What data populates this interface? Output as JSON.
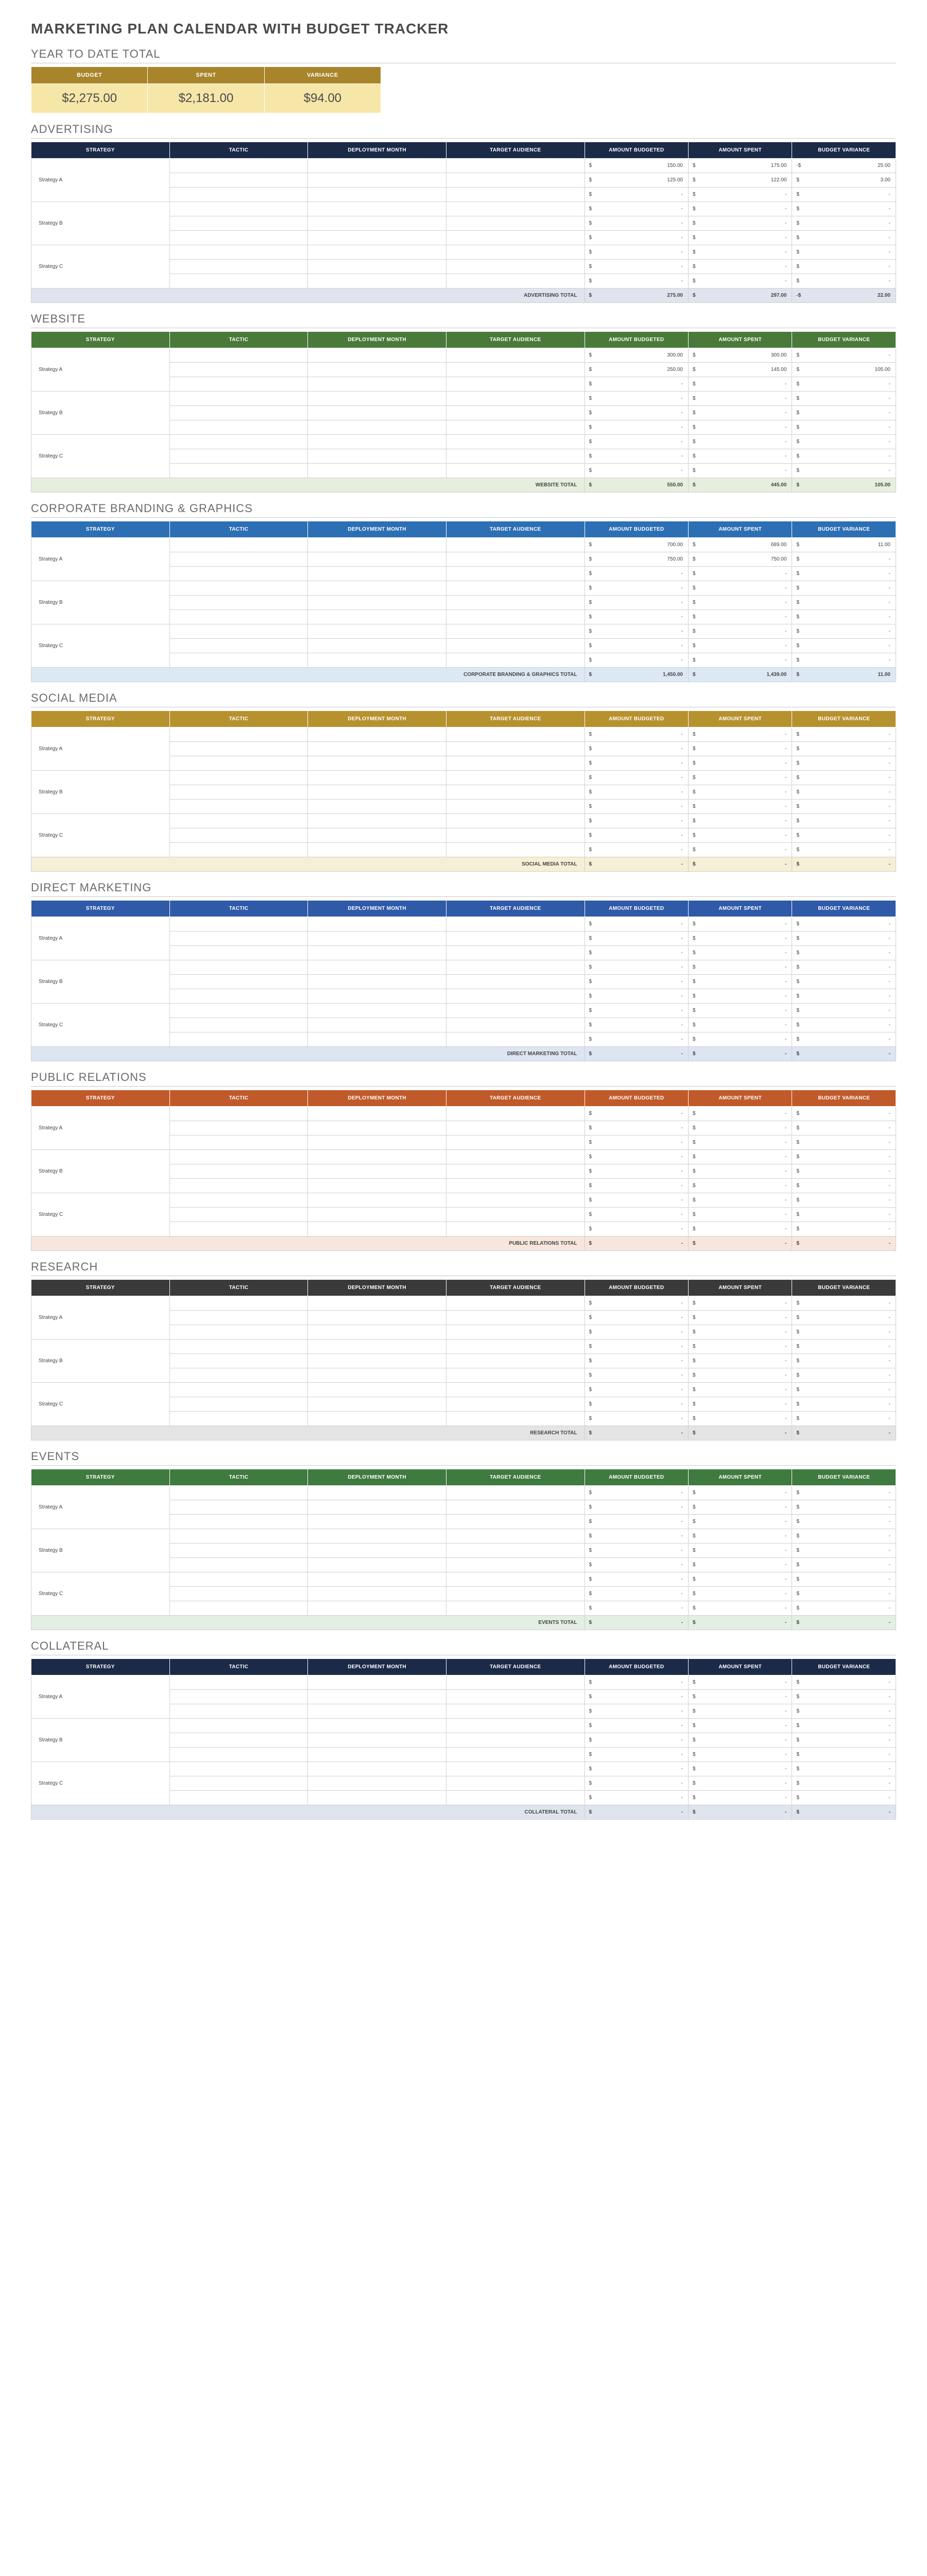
{
  "title": "MARKETING PLAN CALENDAR WITH BUDGET TRACKER",
  "ytd": {
    "title": "YEAR TO DATE TOTAL",
    "headers": {
      "budget": "BUDGET",
      "spent": "SPENT",
      "variance": "VARIANCE"
    },
    "values": {
      "budget": "$2,275.00",
      "spent": "$2,181.00",
      "variance": "$94.00"
    }
  },
  "columns": {
    "strategy": "STRATEGY",
    "tactic": "TACTIC",
    "month": "DEPLOYMENT MONTH",
    "audience": "TARGET AUDIENCE",
    "budgeted": "AMOUNT BUDGETED",
    "spent": "AMOUNT SPENT",
    "variance": "BUDGET VARIANCE"
  },
  "currency": "$",
  "dash": "-",
  "strategies": {
    "a": "Strategy A",
    "b": "Strategy B",
    "c": "Strategy C"
  },
  "sections": [
    {
      "id": "advertising",
      "title": "ADVERTISING",
      "hdrClass": "hdr-navy",
      "totClass": "tot-navy",
      "rows": [
        {
          "strategy": "a",
          "span": 3,
          "cells": [
            {
              "budgeted": "150.00",
              "spent": "175.00",
              "variance": "25.00",
              "varNeg": true
            },
            {
              "budgeted": "125.00",
              "spent": "122.00",
              "variance": "3.00"
            },
            {}
          ]
        },
        {
          "strategy": "b",
          "span": 3,
          "cells": [
            {},
            {},
            {}
          ]
        },
        {
          "strategy": "c",
          "span": 3,
          "cells": [
            {},
            {},
            {}
          ]
        }
      ],
      "total": {
        "label": "ADVERTISING TOTAL",
        "budgeted": "275.00",
        "spent": "297.00",
        "variance": "22.00",
        "varNeg": true
      }
    },
    {
      "id": "website",
      "title": "WEBSITE",
      "hdrClass": "hdr-green",
      "totClass": "tot-green",
      "rows": [
        {
          "strategy": "a",
          "span": 3,
          "cells": [
            {
              "budgeted": "300.00",
              "spent": "300.00",
              "variance": "-"
            },
            {
              "budgeted": "250.00",
              "spent": "145.00",
              "variance": "105.00"
            },
            {}
          ]
        },
        {
          "strategy": "b",
          "span": 3,
          "cells": [
            {},
            {},
            {}
          ]
        },
        {
          "strategy": "c",
          "span": 3,
          "cells": [
            {},
            {},
            {}
          ]
        }
      ],
      "total": {
        "label": "WEBSITE TOTAL",
        "budgeted": "550.00",
        "spent": "445.00",
        "variance": "105.00"
      }
    },
    {
      "id": "corporate",
      "title": "CORPORATE BRANDING & GRAPHICS",
      "hdrClass": "hdr-blue",
      "totClass": "tot-blue",
      "rows": [
        {
          "strategy": "a",
          "span": 3,
          "cells": [
            {
              "budgeted": "700.00",
              "spent": "689.00",
              "variance": "11.00"
            },
            {
              "budgeted": "750.00",
              "spent": "750.00",
              "variance": "-"
            },
            {}
          ]
        },
        {
          "strategy": "b",
          "span": 3,
          "cells": [
            {},
            {},
            {}
          ]
        },
        {
          "strategy": "c",
          "span": 3,
          "cells": [
            {},
            {},
            {}
          ]
        }
      ],
      "total": {
        "label": "CORPORATE BRANDING & GRAPHICS TOTAL",
        "budgeted": "1,450.00",
        "spent": "1,439.00",
        "variance": "11.00"
      }
    },
    {
      "id": "social",
      "title": "SOCIAL MEDIA",
      "hdrClass": "hdr-gold",
      "totClass": "tot-gold",
      "rows": [
        {
          "strategy": "a",
          "span": 3,
          "cells": [
            {},
            {},
            {}
          ]
        },
        {
          "strategy": "b",
          "span": 3,
          "cells": [
            {},
            {},
            {}
          ]
        },
        {
          "strategy": "c",
          "span": 3,
          "cells": [
            {},
            {},
            {}
          ]
        }
      ],
      "total": {
        "label": "SOCIAL MEDIA TOTAL",
        "budgeted": "-",
        "spent": "-",
        "variance": "-"
      }
    },
    {
      "id": "direct",
      "title": "DIRECT MARKETING",
      "hdrClass": "hdr-blue2",
      "totClass": "tot-blue2",
      "rows": [
        {
          "strategy": "a",
          "span": 3,
          "cells": [
            {},
            {},
            {}
          ]
        },
        {
          "strategy": "b",
          "span": 3,
          "cells": [
            {},
            {},
            {}
          ]
        },
        {
          "strategy": "c",
          "span": 3,
          "cells": [
            {},
            {},
            {}
          ]
        }
      ],
      "total": {
        "label": "DIRECT MARKETING TOTAL",
        "budgeted": "-",
        "spent": "-",
        "variance": "-"
      }
    },
    {
      "id": "pr",
      "title": "PUBLIC RELATIONS",
      "hdrClass": "hdr-orange",
      "totClass": "tot-orange",
      "rows": [
        {
          "strategy": "a",
          "span": 3,
          "cells": [
            {},
            {},
            {}
          ]
        },
        {
          "strategy": "b",
          "span": 3,
          "cells": [
            {},
            {},
            {}
          ]
        },
        {
          "strategy": "c",
          "span": 3,
          "cells": [
            {},
            {},
            {}
          ]
        }
      ],
      "total": {
        "label": "PUBLIC RELATIONS TOTAL",
        "budgeted": "-",
        "spent": "-",
        "variance": "-"
      }
    },
    {
      "id": "research",
      "title": "RESEARCH",
      "hdrClass": "hdr-dark",
      "totClass": "tot-dark",
      "rows": [
        {
          "strategy": "a",
          "span": 3,
          "cells": [
            {},
            {},
            {}
          ]
        },
        {
          "strategy": "b",
          "span": 3,
          "cells": [
            {},
            {},
            {}
          ]
        },
        {
          "strategy": "c",
          "span": 3,
          "cells": [
            {},
            {},
            {}
          ]
        }
      ],
      "total": {
        "label": "RESEARCH TOTAL",
        "budgeted": "-",
        "spent": "-",
        "variance": "-"
      }
    },
    {
      "id": "events",
      "title": "EVENTS",
      "hdrClass": "hdr-green2",
      "totClass": "tot-green2",
      "rows": [
        {
          "strategy": "a",
          "span": 3,
          "cells": [
            {},
            {},
            {}
          ]
        },
        {
          "strategy": "b",
          "span": 3,
          "cells": [
            {},
            {},
            {}
          ]
        },
        {
          "strategy": "c",
          "span": 3,
          "cells": [
            {},
            {},
            {}
          ]
        }
      ],
      "total": {
        "label": "EVENTS TOTAL",
        "budgeted": "-",
        "spent": "-",
        "variance": "-"
      }
    },
    {
      "id": "collateral",
      "title": "COLLATERAL",
      "hdrClass": "hdr-navy2",
      "totClass": "tot-navy2",
      "rows": [
        {
          "strategy": "a",
          "span": 3,
          "cells": [
            {},
            {},
            {}
          ]
        },
        {
          "strategy": "b",
          "span": 3,
          "cells": [
            {},
            {},
            {}
          ]
        },
        {
          "strategy": "c",
          "span": 3,
          "cells": [
            {},
            {},
            {}
          ]
        }
      ],
      "total": {
        "label": "COLLATERAL TOTAL",
        "budgeted": "-",
        "spent": "-",
        "variance": "-"
      }
    }
  ]
}
